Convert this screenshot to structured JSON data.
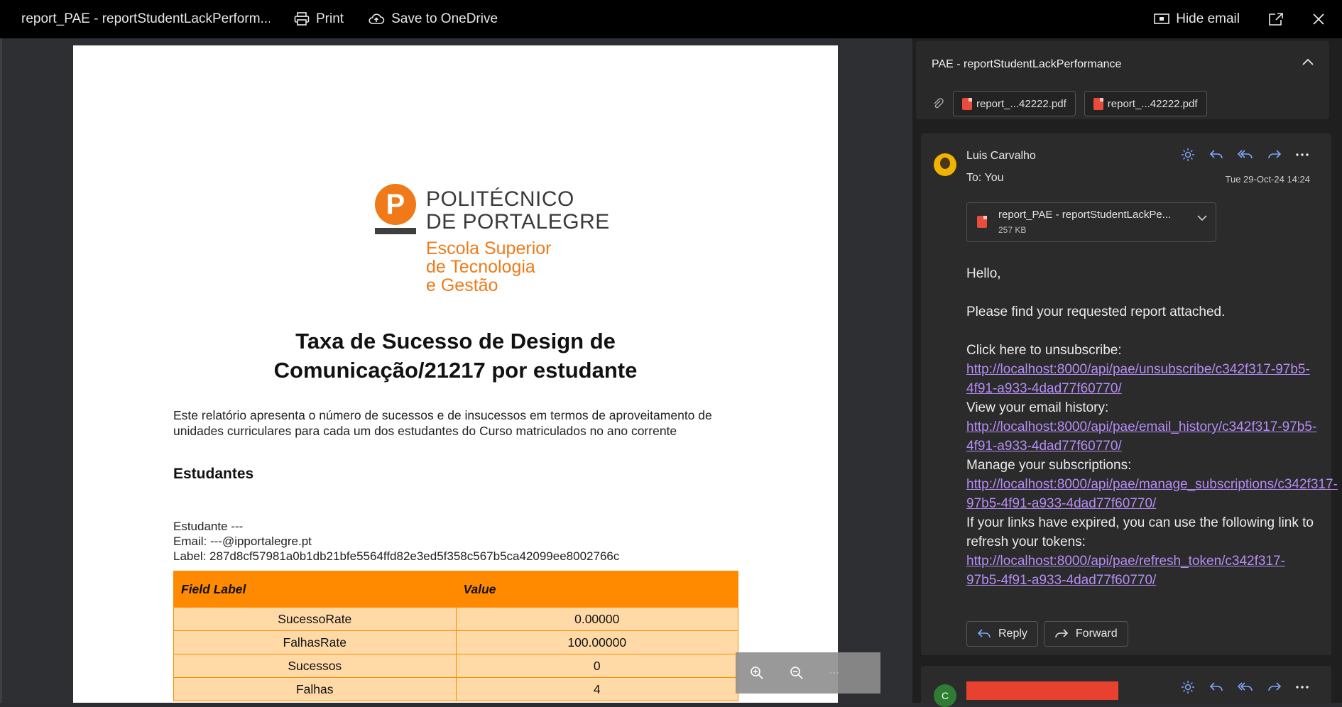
{
  "window": {
    "title": "report_PAE - reportStudentLackPerform...",
    "print_label": "Print",
    "save_label": "Save to OneDrive",
    "hide_email_label": "Hide email"
  },
  "document": {
    "logo_name_line1": "POLITÉCNICO",
    "logo_name_line2": "DE PORTALEGRE",
    "logo_school_line1": "Escola Superior",
    "logo_school_line2": "de Tecnologia",
    "logo_school_line3": "e Gestão",
    "logo_letter": "P",
    "title_line1": "Taxa de Sucesso de Design de",
    "title_line2": "Comunicação/21217 por estudante",
    "description": "Este relatório apresenta o número de sucessos e de insucessos em termos de aproveitamento de unidades curriculares para cada um dos estudantes do Curso matriculados no ano corrente",
    "section_title": "Estudantes",
    "student_name": "Estudante ---",
    "student_email": "Email: ---@ipportalegre.pt",
    "student_label": "Label: 287d8cf57981a0b1db21bfe5564ffd82e3ed5f358c567b5ca42099ee8002766c",
    "table_headers": [
      "Field Label",
      "Value"
    ],
    "table_rows": [
      {
        "field": "SucessoRate",
        "value": "0.00000"
      },
      {
        "field": "FalhasRate",
        "value": "100.00000"
      },
      {
        "field": "Sucessos",
        "value": "0"
      },
      {
        "field": "Falhas",
        "value": "4"
      }
    ]
  },
  "email": {
    "subject": "PAE - reportStudentLackPerformance",
    "attachments": [
      "report_...42222.pdf",
      "report_...42222.pdf"
    ],
    "sender": "Luis Carvalho",
    "to": "To: You",
    "date": "Tue 29-Oct-24 14:24",
    "attachment_name": "report_PAE - reportStudentLackPe...",
    "attachment_size": "257 KB",
    "greeting": "Hello,",
    "intro": "Please find your requested report attached.",
    "unsubscribe_text": "Click here to unsubscribe: ",
    "unsubscribe_link": "http://localhost:8000/api/pae/unsubscribe/c342f317-97b5-4f91-a933-4dad77f60770/",
    "history_text": "View your email history: ",
    "history_link": "http://localhost:8000/api/pae/email_history/c342f317-97b5-4f91-a933-4dad77f60770/",
    "manage_text": "Manage your subscriptions: ",
    "manage_link": "http://localhost:8000/api/pae/manage_subscriptions/c342f317-97b5-4f91-a933-4dad77f60770/",
    "expired_text": "If your links have expired, you can use the following link to refresh your tokens: ",
    "refresh_link": "http://localhost:8000/api/pae/refresh_token/c342f317-97b5-4f91-a933-4dad77f60770/",
    "reply_label": "Reply",
    "forward_label": "Forward",
    "second_avatar_letter": "C"
  },
  "colors": {
    "accent_orange": "#ff8a00",
    "link_purple": "#b58cf5",
    "redaction": "#e8412f"
  }
}
